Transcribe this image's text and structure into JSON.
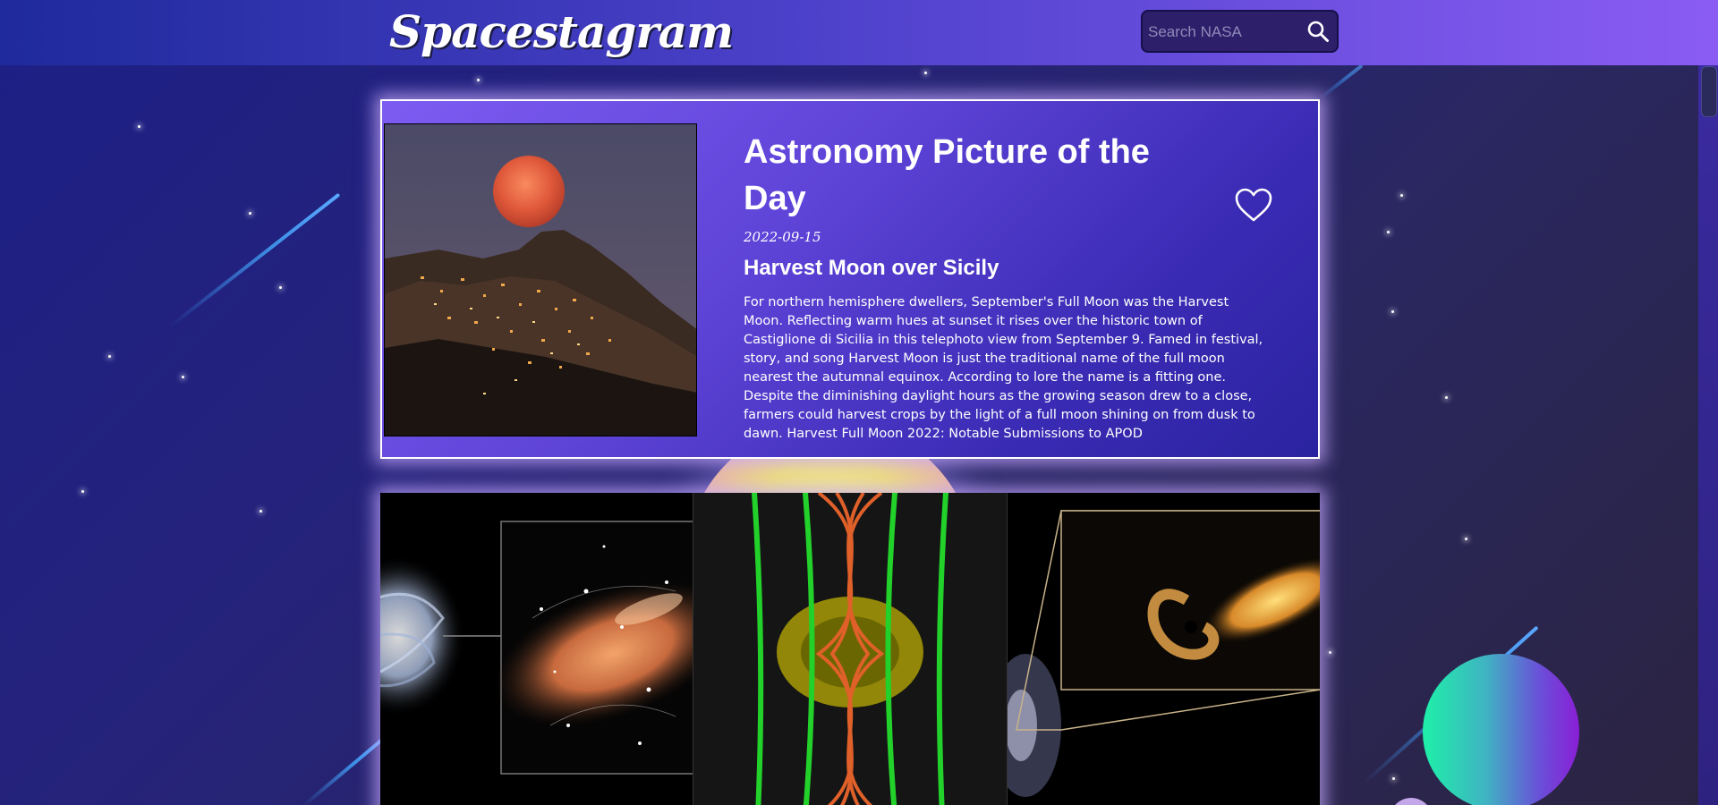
{
  "header": {
    "logo": "Spacestagram",
    "search": {
      "placeholder": "Search NASA",
      "value": "",
      "button_icon": "search-icon"
    }
  },
  "apod": {
    "heading": "Astronomy Picture of the Day",
    "date": "2022-09-15",
    "title": "Harvest Moon over Sicily",
    "explanation": "For northern hemisphere dwellers, September's Full Moon was the Harvest Moon. Reflecting warm hues at sunset it rises over the historic town of Castiglione di Sicilia in this telephoto view from September 9. Famed in festival, story, and song Harvest Moon is just the traditional name of the full moon nearest the autumnal equinox. According to lore the name is a fitting one. Despite the diminishing daylight hours as the growing season drew to a close, farmers could harvest crops by the light of a full moon shining on from dusk to dawn. Harvest Full Moon 2022: Notable Submissions to APOD",
    "like_icon": "heart-outline-icon",
    "liked": false
  },
  "gallery": {
    "tiles": [
      {
        "icon": "galaxy-image"
      },
      {
        "icon": "magnetic-field-image"
      },
      {
        "icon": "black-hole-image"
      }
    ]
  },
  "colors": {
    "header_start": "#1f2a9c",
    "header_end": "#8a5cf4",
    "card_glow": "#c8aaff",
    "card_start": "#7d5cf2",
    "card_end": "#2a23a0"
  }
}
